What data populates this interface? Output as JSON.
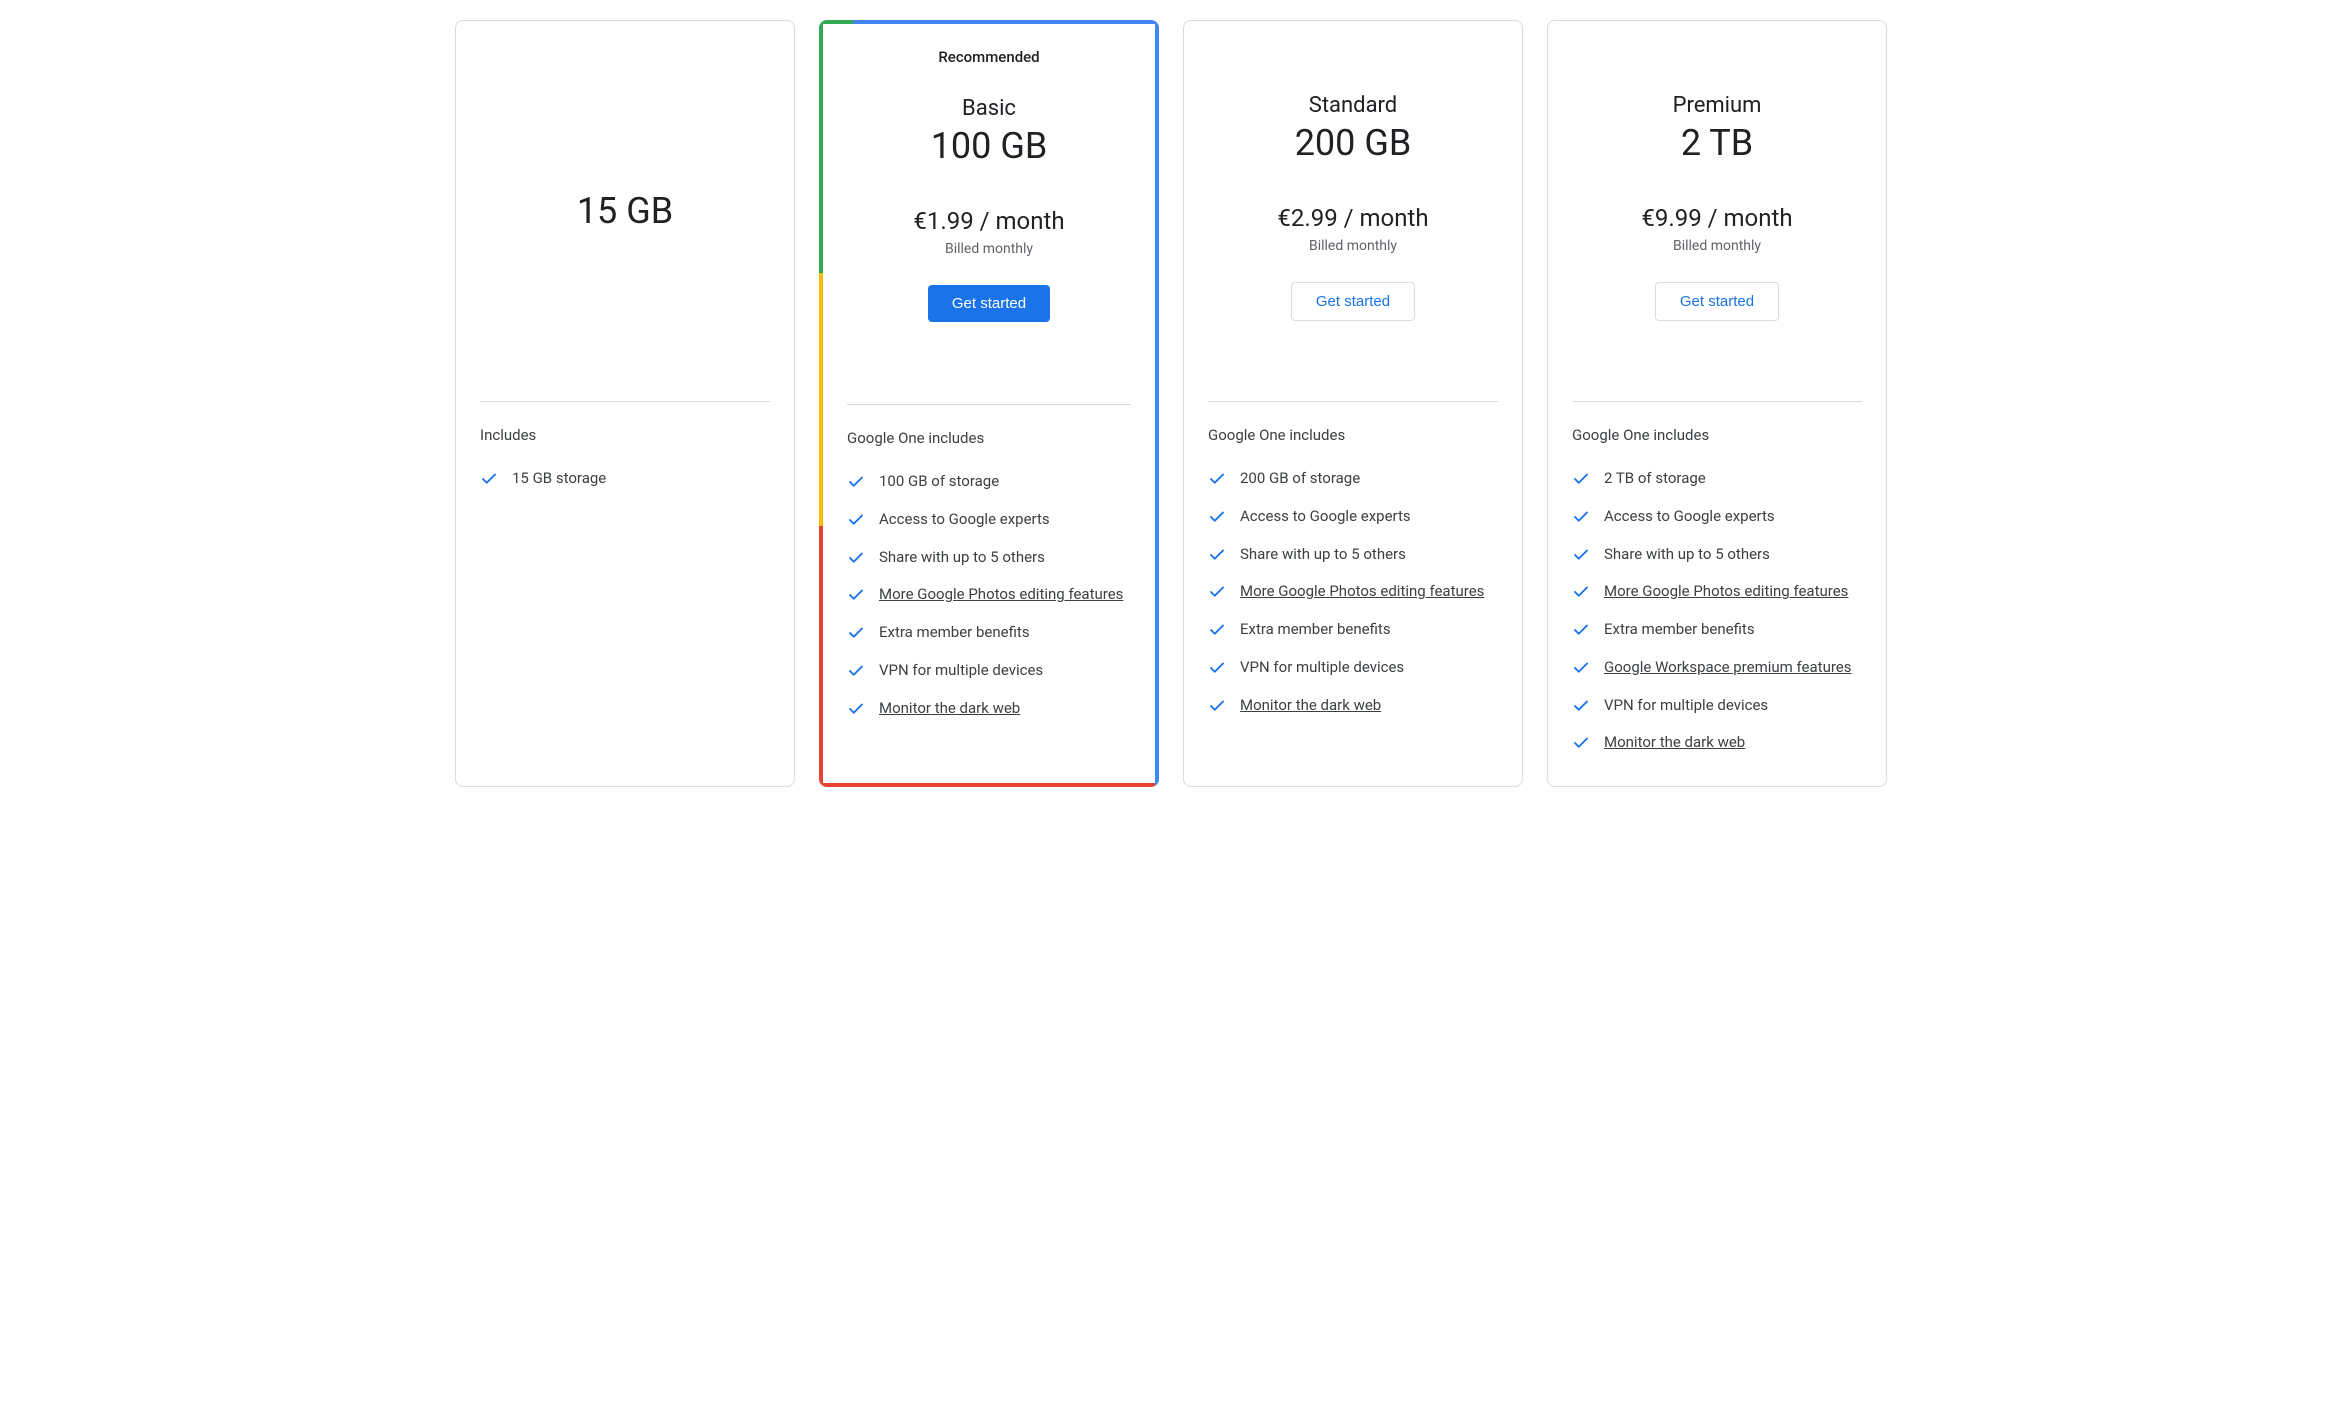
{
  "plans": [
    {
      "recommended_label": "",
      "name": "",
      "storage": "15 GB",
      "price": "",
      "billing": "",
      "cta": "",
      "features_title": "Includes",
      "features": [
        {
          "text": "15 GB storage",
          "link": false
        }
      ]
    },
    {
      "recommended_label": "Recommended",
      "name": "Basic",
      "storage": "100 GB",
      "price": "€1.99 / month",
      "billing": "Billed monthly",
      "cta": "Get started",
      "features_title": "Google One includes",
      "features": [
        {
          "text": "100 GB of storage",
          "link": false
        },
        {
          "text": "Access to Google experts",
          "link": false
        },
        {
          "text": "Share with up to 5 others",
          "link": false
        },
        {
          "text": "More Google Photos editing features",
          "link": true
        },
        {
          "text": "Extra member benefits",
          "link": false
        },
        {
          "text": "VPN for multiple devices",
          "link": false
        },
        {
          "text": "Monitor the dark web",
          "link": true
        }
      ]
    },
    {
      "recommended_label": "",
      "name": "Standard",
      "storage": "200 GB",
      "price": "€2.99 / month",
      "billing": "Billed monthly",
      "cta": "Get started",
      "features_title": "Google One includes",
      "features": [
        {
          "text": "200 GB of storage",
          "link": false
        },
        {
          "text": "Access to Google experts",
          "link": false
        },
        {
          "text": "Share with up to 5 others",
          "link": false
        },
        {
          "text": "More Google Photos editing features",
          "link": true
        },
        {
          "text": "Extra member benefits",
          "link": false
        },
        {
          "text": "VPN for multiple devices",
          "link": false
        },
        {
          "text": "Monitor the dark web",
          "link": true
        }
      ]
    },
    {
      "recommended_label": "",
      "name": "Premium",
      "storage": "2 TB",
      "price": "€9.99 / month",
      "billing": "Billed monthly",
      "cta": "Get started",
      "features_title": "Google One includes",
      "features": [
        {
          "text": "2 TB of storage",
          "link": false
        },
        {
          "text": "Access to Google experts",
          "link": false
        },
        {
          "text": "Share with up to 5 others",
          "link": false
        },
        {
          "text": "More Google Photos editing features",
          "link": true
        },
        {
          "text": "Extra member benefits",
          "link": false
        },
        {
          "text": "Google Workspace premium features",
          "link": true
        },
        {
          "text": "VPN for multiple devices",
          "link": false
        },
        {
          "text": "Monitor the dark web",
          "link": true
        }
      ]
    }
  ]
}
